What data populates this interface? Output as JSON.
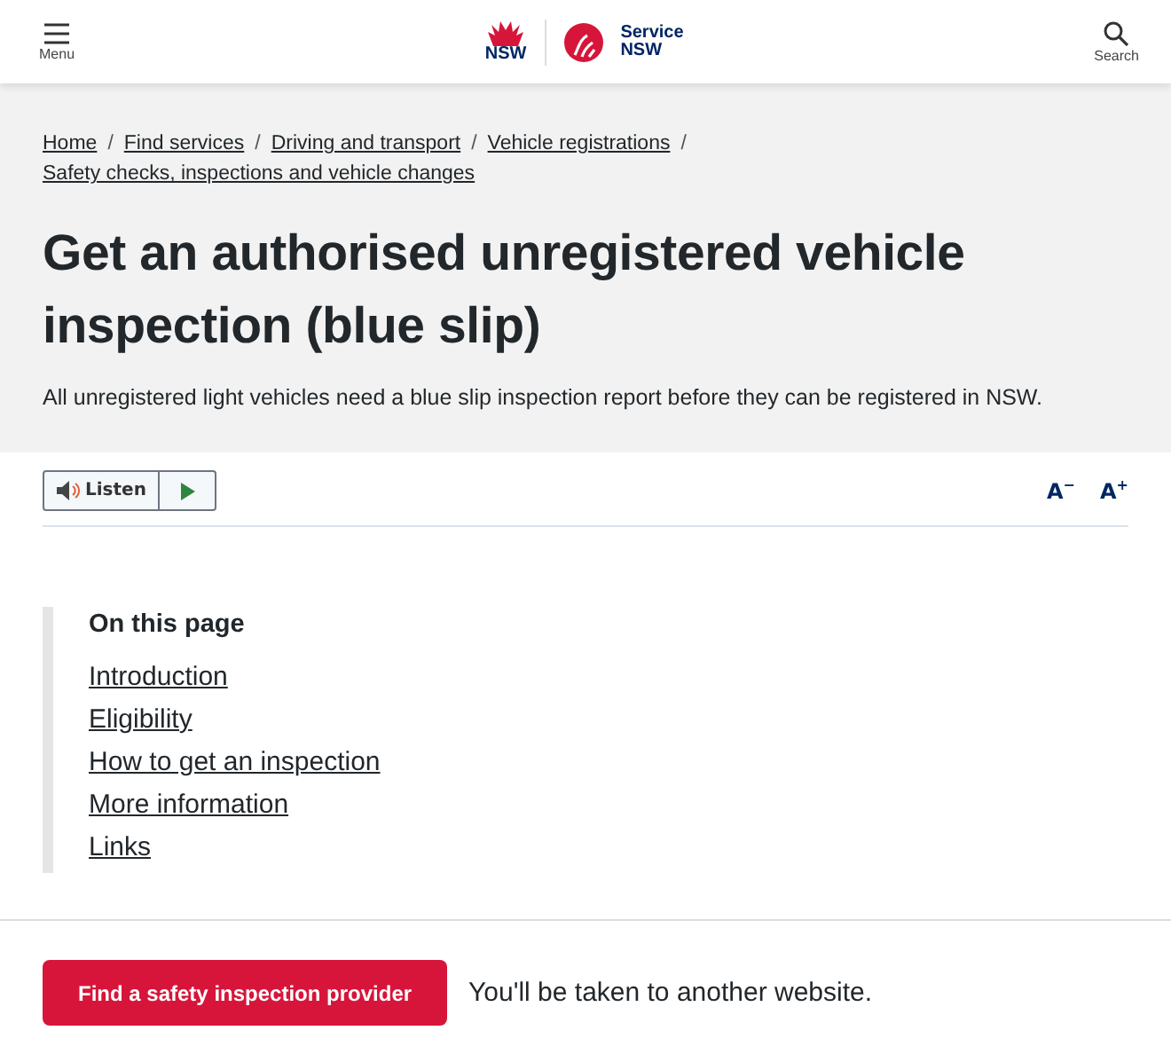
{
  "header": {
    "menu_label": "Menu",
    "logo_text": "NSW",
    "brand": [
      "Service",
      "NSW"
    ],
    "search_label": "Search"
  },
  "breadcrumbs": [
    "Home",
    "Find services",
    "Driving and transport",
    "Vehicle registrations",
    "Safety checks, inspections and vehicle changes"
  ],
  "breadcrumb_separator": "/",
  "title": "Get an authorised unregistered vehicle inspection (blue slip)",
  "intro": "All unregistered light vehicles need a blue slip inspection report before they can be registered in NSW.",
  "toolbar": {
    "listen_label": "Listen",
    "text_size": [
      "A$^{−}$",
      "A$^{+}$"
    ]
  },
  "on_this_page": {
    "heading": "On this page",
    "links": [
      "Introduction",
      "Eligibility",
      "How to get an inspection",
      "More information",
      "Links"
    ]
  },
  "cta": {
    "button": "Find a safety inspection provider",
    "note": "You'll be taken to another website."
  }
}
